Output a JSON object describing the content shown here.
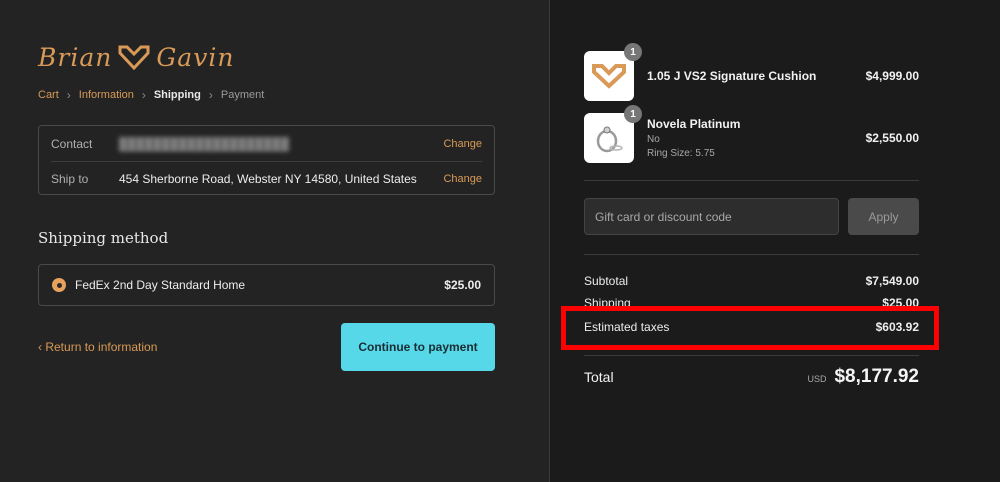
{
  "brand": {
    "first": "Brian",
    "last": "Gavin",
    "accent": "#d99a57"
  },
  "breadcrumb": {
    "items": [
      "Cart",
      "Information",
      "Shipping",
      "Payment"
    ],
    "separator": "›"
  },
  "info": {
    "contact_label": "Contact",
    "contact_value": "",
    "ship_label": "Ship to",
    "ship_value": "454 Sherborne Road, Webster NY 14580, United States",
    "change_label": "Change"
  },
  "shipping": {
    "heading": "Shipping method",
    "option_name": "FedEx 2nd Day Standard Home",
    "option_price": "$25.00"
  },
  "actions": {
    "return_label": "Return to information",
    "continue_label": "Continue to payment",
    "continue_color": "#56d8e9"
  },
  "products": [
    {
      "qty": "1",
      "name": "1.05 J VS2 Signature Cushion",
      "price": "$4,999.00",
      "icon": "brand-logo-icon"
    },
    {
      "qty": "1",
      "name": "Novela Platinum",
      "option": "No",
      "size": "Ring Size: 5.75",
      "price": "$2,550.00",
      "icon": "ring-icon"
    }
  ],
  "discount": {
    "placeholder": "Gift card or discount code",
    "apply_label": "Apply"
  },
  "totals": {
    "subtotal_label": "Subtotal",
    "subtotal_value": "$7,549.00",
    "shipping_label": "Shipping",
    "shipping_value": "$25.00",
    "tax_label": "Estimated taxes",
    "tax_value": "$603.92",
    "total_label": "Total",
    "currency": "USD",
    "total_value": "$8,177.92",
    "highlight_color": "#ff0000"
  }
}
